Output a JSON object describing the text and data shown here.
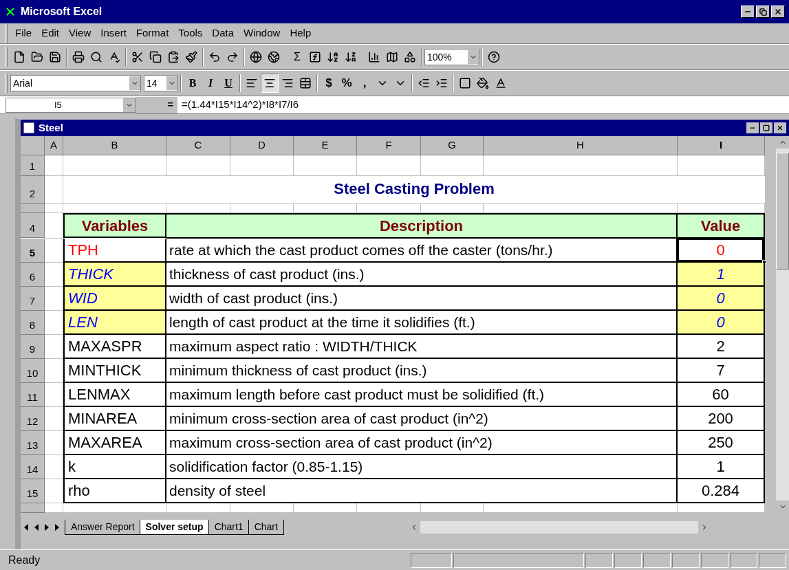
{
  "window": {
    "title": "Microsoft Excel"
  },
  "menu": [
    "File",
    "Edit",
    "View",
    "Insert",
    "Format",
    "Tools",
    "Data",
    "Window",
    "Help"
  ],
  "standard_toolbar": {
    "autosum": "Σ",
    "zoom": "100%"
  },
  "formatting_toolbar": {
    "font": "Arial",
    "size": "14",
    "styles": [
      "B",
      "I",
      "U"
    ],
    "number_formats": [
      "$",
      "%",
      ","
    ]
  },
  "formula_bar": {
    "name_box": "I5",
    "equals": "=",
    "formula": "=(1.44*I15*I14^2)*I8*I7/I6"
  },
  "workbook": {
    "title": "Steel",
    "columns": [
      {
        "label": "A",
        "selected": false
      },
      {
        "label": "B",
        "selected": false
      },
      {
        "label": "C",
        "selected": false
      },
      {
        "label": "D",
        "selected": false
      },
      {
        "label": "E",
        "selected": false
      },
      {
        "label": "F",
        "selected": false
      },
      {
        "label": "G",
        "selected": false
      },
      {
        "label": "H",
        "selected": false
      },
      {
        "label": "I",
        "selected": true
      }
    ],
    "blank_row": "1",
    "title_row": {
      "row": "2",
      "title": "Steel Casting Problem"
    },
    "table": {
      "header_row": "4",
      "headers": [
        "Variables",
        "Description",
        "Value"
      ],
      "rows": [
        {
          "row": "5",
          "variable": "TPH",
          "description": "rate at which the cast product comes off the caster (tons/hr.)",
          "value": "0",
          "kind": "output",
          "selected": true
        },
        {
          "row": "6",
          "variable": "THICK",
          "description": "thickness of cast product (ins.)",
          "value": "1",
          "kind": "decision",
          "selected": false
        },
        {
          "row": "7",
          "variable": "WID",
          "description": "width of cast product (ins.)",
          "value": "0",
          "kind": "decision",
          "selected": false
        },
        {
          "row": "8",
          "variable": "LEN",
          "description": "length of cast product at the time it solidifies (ft.)",
          "value": "0",
          "kind": "decision",
          "selected": false
        },
        {
          "row": "9",
          "variable": "MAXASPR",
          "description": "maximum aspect ratio : WIDTH/THICK",
          "value": "2",
          "kind": "parameter",
          "selected": false
        },
        {
          "row": "10",
          "variable": "MINTHICK",
          "description": "minimum thickness of cast product (ins.)",
          "value": "7",
          "kind": "parameter",
          "selected": false
        },
        {
          "row": "11",
          "variable": "LENMAX",
          "description": "maximum length before cast product must be solidified (ft.)",
          "value": "60",
          "kind": "parameter",
          "selected": false
        },
        {
          "row": "12",
          "variable": "MINAREA",
          "description": "minimum cross-section area of cast product (in^2)",
          "value": "200",
          "kind": "parameter",
          "selected": false
        },
        {
          "row": "13",
          "variable": "MAXAREA",
          "description": "maximum cross-section area of cast product (in^2)",
          "value": "250",
          "kind": "parameter",
          "selected": false
        },
        {
          "row": "14",
          "variable": "k",
          "description": "solidification factor (0.85-1.15)",
          "value": "1",
          "kind": "parameter",
          "selected": false
        },
        {
          "row": "15",
          "variable": "rho",
          "description": "density of steel",
          "value": "0.284",
          "kind": "parameter",
          "selected": false
        }
      ]
    },
    "sheet_tabs": [
      {
        "label": "Answer Report",
        "selected": false
      },
      {
        "label": "Solver setup",
        "selected": true
      },
      {
        "label": "Chart1",
        "selected": false
      },
      {
        "label": "Chart",
        "selected": false
      }
    ]
  },
  "status_bar": {
    "text": "Ready"
  }
}
